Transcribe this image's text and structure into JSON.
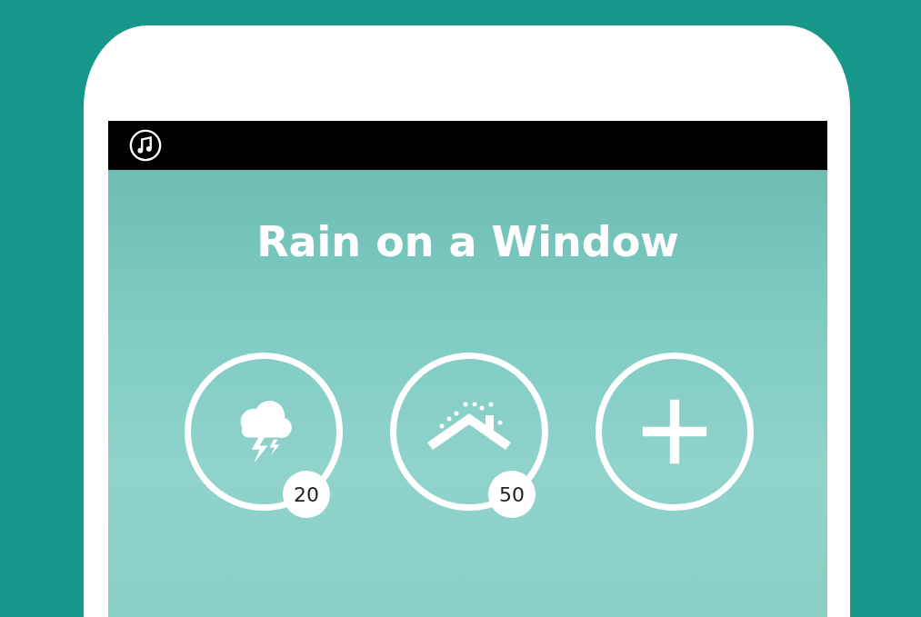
{
  "title": "Rain on a Window",
  "sounds": [
    {
      "kind": "storm",
      "volume": "20"
    },
    {
      "kind": "roof",
      "volume": "50"
    },
    {
      "kind": "add"
    }
  ]
}
